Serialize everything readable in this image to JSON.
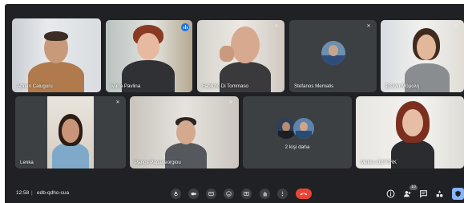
{
  "participants": [
    {
      "name": "Adrian Caluguru"
    },
    {
      "name": "Ivana Pavlina"
    },
    {
      "name": "Fabrizio Di Tommaso"
    },
    {
      "name": "Stefanos Memalis"
    },
    {
      "name": "Στέλλα Μόμολη"
    },
    {
      "name": "Lenka"
    },
    {
      "name": "Panos Papageorgiou"
    },
    {
      "name": "Melike ÖZTÜRK"
    }
  ],
  "others_tile": {
    "label": "2 kişi daha"
  },
  "bottom_bar": {
    "time": "12:58",
    "separator": "|",
    "meeting_code": "edb-qdho-cua",
    "participant_count": "10"
  },
  "colors": {
    "meet_bg": "#202124",
    "tile_bg": "#3c4043",
    "active_speaker": "#8ab4f8",
    "end_call": "#ea4335",
    "accent": "#1a73e8"
  },
  "icons": [
    "microphone-icon",
    "camera-icon",
    "captions-icon",
    "emoji-icon",
    "present-screen-icon",
    "raise-hand-icon",
    "more-options-icon",
    "end-call-icon",
    "info-icon",
    "people-icon",
    "chat-icon",
    "activities-icon",
    "host-controls-icon"
  ]
}
